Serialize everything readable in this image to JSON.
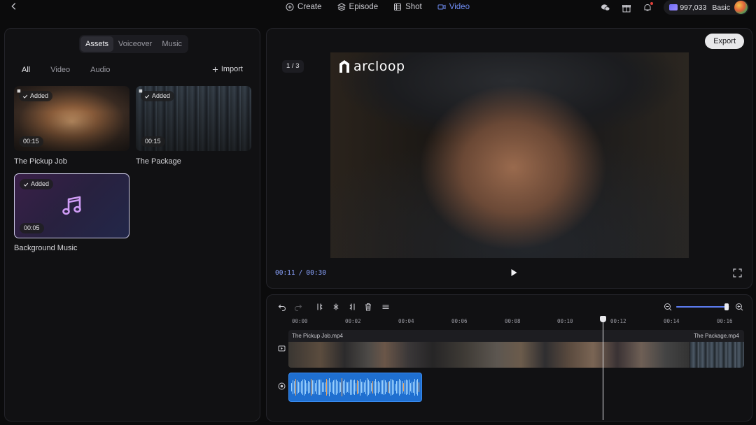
{
  "nav": {
    "items": [
      {
        "label": "Create",
        "icon": "plus-circle-icon"
      },
      {
        "label": "Episode",
        "icon": "layers-icon"
      },
      {
        "label": "Shot",
        "icon": "film-icon"
      },
      {
        "label": "Video",
        "icon": "video-icon"
      }
    ],
    "active": "Video"
  },
  "account": {
    "credits": "997,033",
    "plan": "Basic"
  },
  "assets": {
    "tabs": [
      "Assets",
      "Voiceover",
      "Music"
    ],
    "active_tab": "Assets",
    "filters": [
      "All",
      "Video",
      "Audio"
    ],
    "active_filter": "All",
    "import_label": "Import",
    "items": [
      {
        "name": "The Pickup Job",
        "status": "Added",
        "duration": "00:15",
        "type": "video"
      },
      {
        "name": "The Package",
        "status": "Added",
        "duration": "00:15",
        "type": "video"
      },
      {
        "name": "Background Music",
        "status": "Added",
        "duration": "00:05",
        "type": "audio"
      }
    ]
  },
  "preview": {
    "page_indicator": "1 / 3",
    "export_label": "Export",
    "logo_text": "arcloop",
    "current_time": "00:11",
    "total_time": "00:30"
  },
  "timeline": {
    "ticks": [
      "00:00",
      "00:02",
      "00:04",
      "00:06",
      "00:08",
      "00:10",
      "00:12",
      "00:14",
      "00:16"
    ],
    "clips": [
      {
        "label": "The Pickup Job.mp4"
      },
      {
        "label": "The Package.mp4"
      }
    ],
    "zoom_level": 0.95
  }
}
